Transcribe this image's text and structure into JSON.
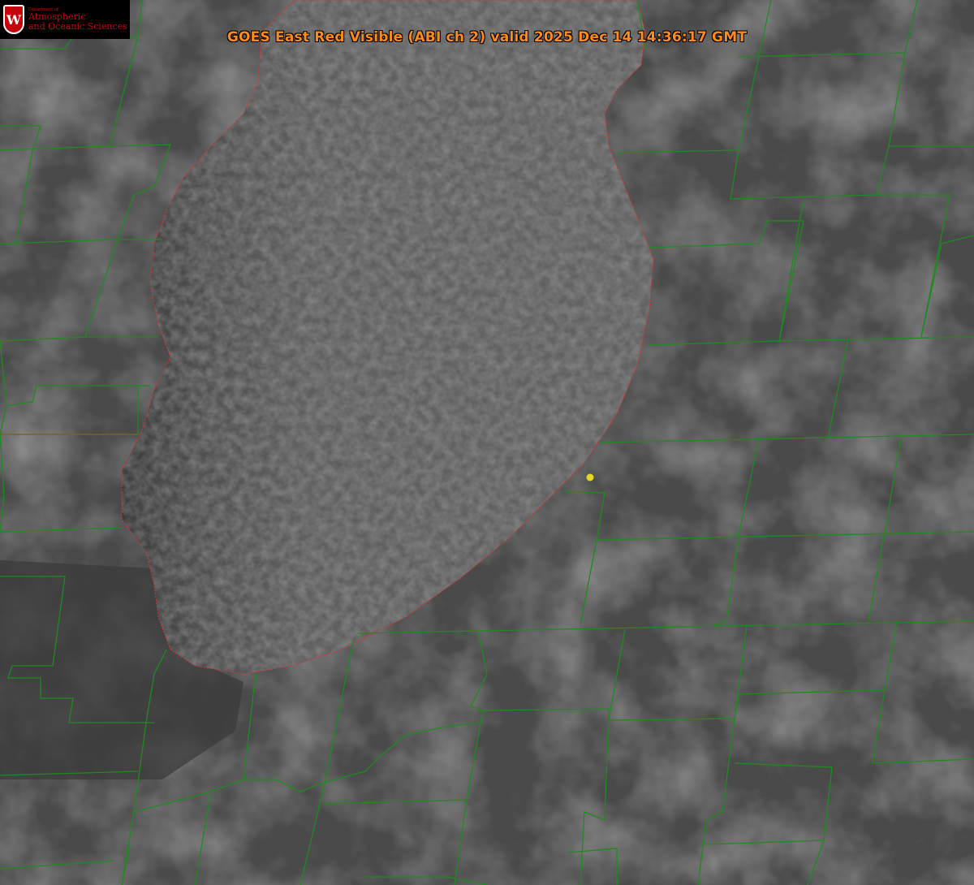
{
  "header": {
    "title": "GOES East Red Visible (ABI ch 2) valid 2025 Dec 14 14:36:17 GMT"
  },
  "logo": {
    "initial": "W",
    "department": "Department of",
    "line1": "Atmospheric",
    "line2": "and Oceanic Sciences"
  },
  "map": {
    "boundary_color": "#1f8a1f",
    "shoreline_color": "#e03030",
    "marker_color": "#e6d820",
    "land_color": "#4a4a4a",
    "lake_color": "#5f5f5f"
  }
}
